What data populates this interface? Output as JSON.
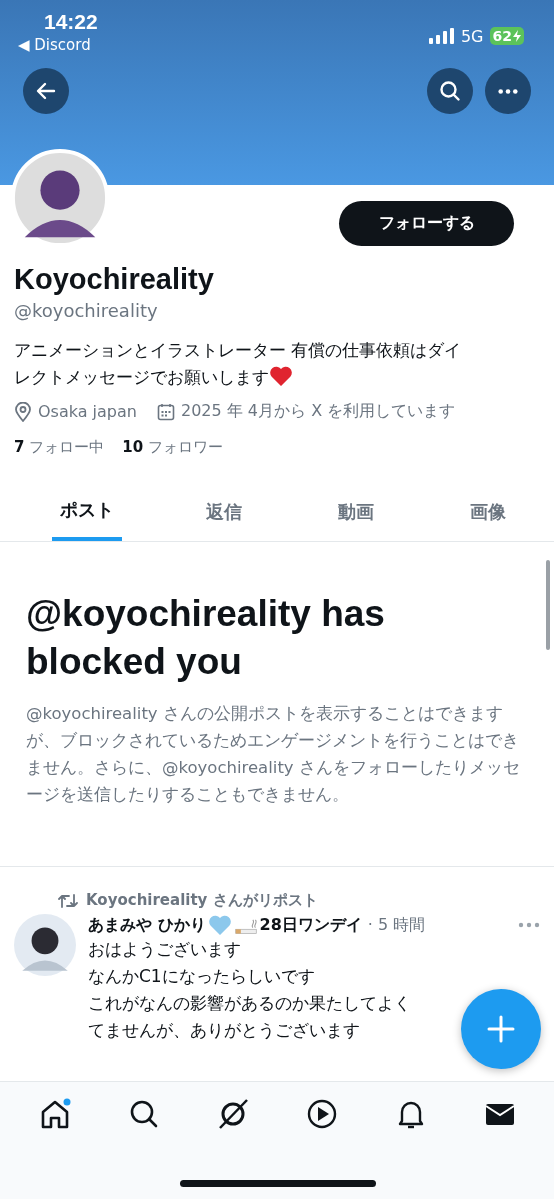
{
  "status_bar": {
    "time": "14:22",
    "back_app": "◀ Discord",
    "network": "5G",
    "battery": "62"
  },
  "profile": {
    "name": "Koyochireality",
    "handle": "@koyochireality",
    "bio_lines": [
      "アニメーションとイラストレーター 有償の仕事依頼はダイ",
      "レクトメッセージでお願いします"
    ],
    "location": "Osaka japan",
    "joined": "2025 年 4月から X を利用しています",
    "following_count": "7",
    "following_label": "フォロー中",
    "followers_count": "10",
    "followers_label": "フォロワー",
    "follow_button": "フォローする"
  },
  "tabs": [
    {
      "label": "ポスト",
      "selected": true
    },
    {
      "label": "返信",
      "selected": false
    },
    {
      "label": "動画",
      "selected": false
    },
    {
      "label": "画像",
      "selected": false
    }
  ],
  "blocked": {
    "title": "@koyochireality has blocked you",
    "message": "@koyochireality さんの公開ポストを表示することはできますが、ブロックされているためエンゲージメントを行うことはできません。さらに、@koyochireality さんをフォローしたりメッセージを送信したりすることもできません。"
  },
  "post": {
    "repost_label": "Koyochireality さんがリポスト",
    "author": "あまみや ひかり",
    "author_suffix": "28日ワンデイ",
    "time": "· 5 時間",
    "lines": [
      "おはようございます",
      "なんかC1になったらしいです",
      "これがなんの影響があるのか果たしてよく",
      "てませんが、ありがとうございます"
    ]
  },
  "bottom_nav": [
    {
      "kind": "home",
      "badge": true
    },
    {
      "kind": "search",
      "badge": false
    },
    {
      "kind": "grok",
      "badge": false
    },
    {
      "kind": "video",
      "badge": false
    },
    {
      "kind": "bell",
      "badge": false
    },
    {
      "kind": "mail",
      "badge": false
    }
  ]
}
